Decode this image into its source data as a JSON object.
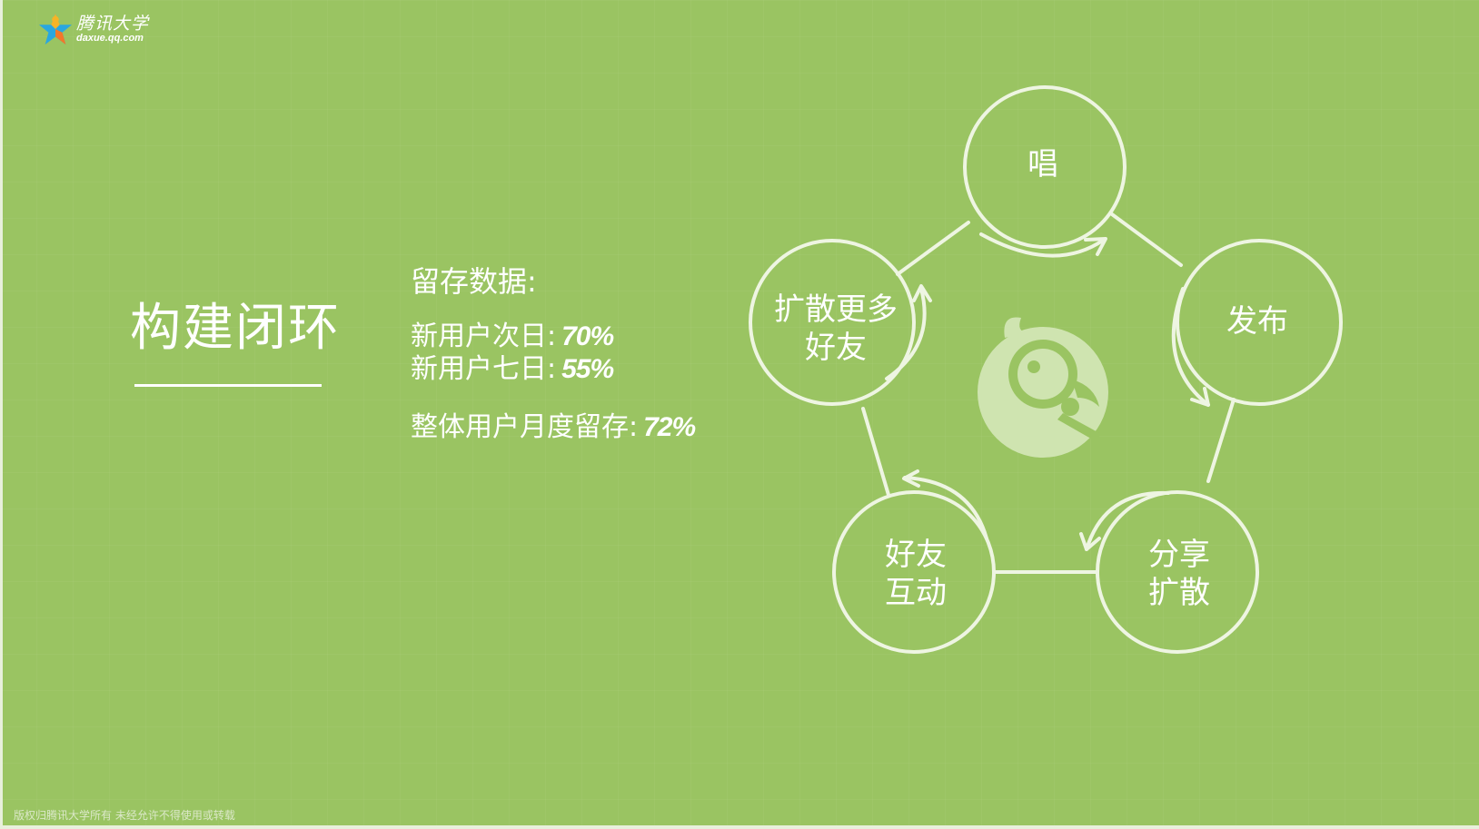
{
  "logo": {
    "name_cn": "腾讯大学",
    "url": "daxue.qq.com"
  },
  "title": "构建闭环",
  "retention": {
    "heading": "留存数据:",
    "rows": [
      {
        "label": "新用户次日:",
        "value": "70%"
      },
      {
        "label": "新用户七日:",
        "value": "55%"
      },
      {
        "label": "整体用户月度留存:",
        "value": "72%"
      }
    ]
  },
  "cycle": {
    "nodes": [
      {
        "label": "唱"
      },
      {
        "label": "发布"
      },
      {
        "label": "分享\n扩散"
      },
      {
        "label": "好友\n互动"
      },
      {
        "label": "扩散更多\n好友"
      }
    ]
  },
  "footer": {
    "copyright": "版权归腾讯大学所有 未经允许不得使用或转载"
  },
  "colors": {
    "background": "#9ac462",
    "circle_stroke": "#eef5e2",
    "text": "#ffffff"
  }
}
